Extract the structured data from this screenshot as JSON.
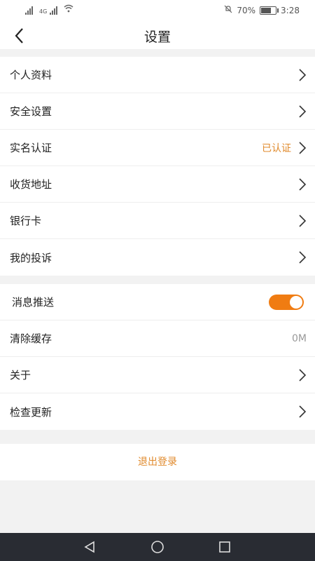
{
  "status_bar": {
    "battery": "70%",
    "time": "3:28",
    "network": "4G"
  },
  "header": {
    "title": "设置"
  },
  "group1": [
    {
      "label": "个人资料"
    },
    {
      "label": "安全设置"
    },
    {
      "label": "实名认证",
      "value": "已认证"
    },
    {
      "label": "收货地址"
    },
    {
      "label": "银行卡"
    },
    {
      "label": "我的投诉"
    }
  ],
  "group2": {
    "push": {
      "label": "消息推送",
      "enabled": true
    },
    "cache": {
      "label": "清除缓存",
      "value": "0M"
    },
    "about": {
      "label": "关于"
    },
    "update": {
      "label": "检查更新"
    }
  },
  "logout": {
    "label": "退出登录"
  },
  "colors": {
    "accent": "#e08a2c",
    "toggle": "#f07c12",
    "background": "#f2f2f2"
  }
}
